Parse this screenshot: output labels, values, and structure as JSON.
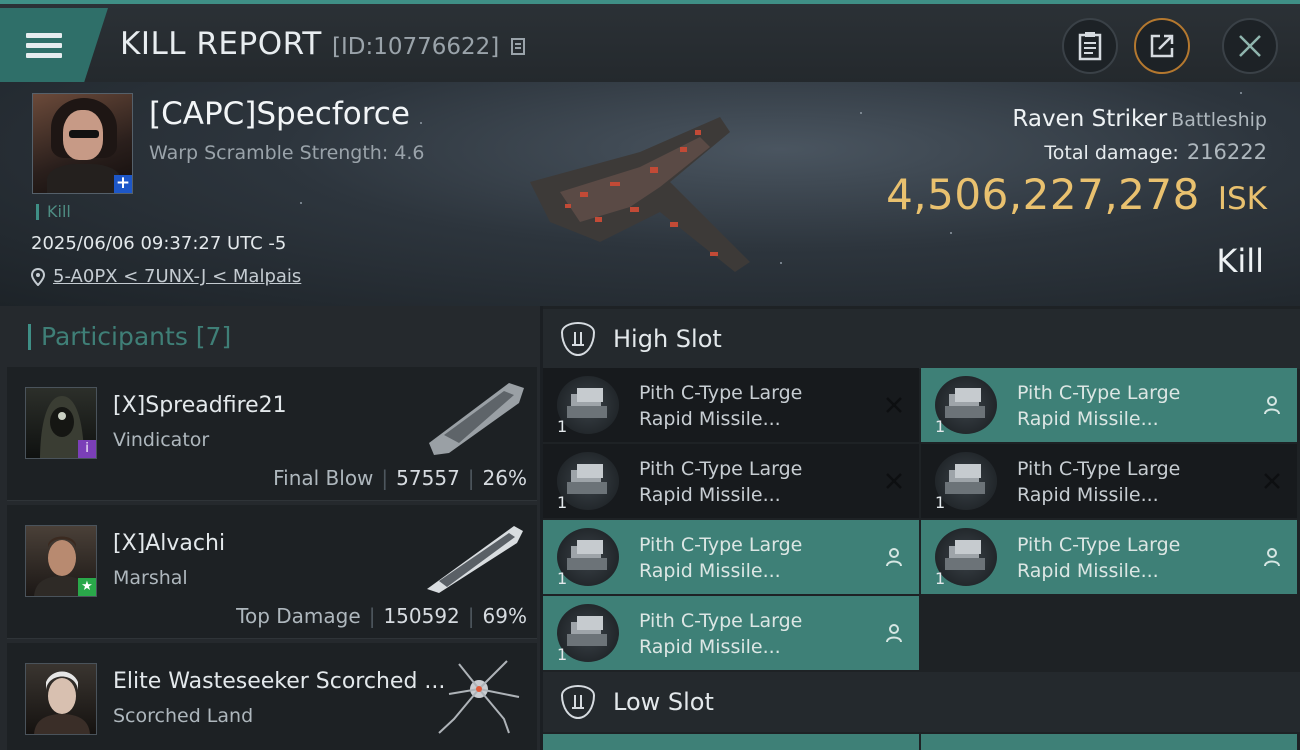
{
  "header": {
    "title": "KILL REPORT",
    "id_label": "[ID:10776622]"
  },
  "victim": {
    "name": "[CAPC]Specforce",
    "scramble": "Warp Scramble Strength: 4.6",
    "kill_tag": "Kill",
    "datetime": "2025/06/06 09:37:27 UTC -5",
    "location": "5-A0PX < 7UNX-J < Malpais",
    "ship_name": "Raven Striker",
    "ship_class": "Battleship",
    "total_damage_label": "Total damage:",
    "total_damage": "216222",
    "isk_value": "4,506,227,278",
    "isk_unit": "ISK",
    "result": "Kill"
  },
  "participants": {
    "heading": "Participants [7]",
    "items": [
      {
        "name": "[X]Spreadfire21",
        "ship": "Vindicator",
        "role": "Final Blow",
        "damage": "57557",
        "percent": "26%"
      },
      {
        "name": "[X]Alvachi",
        "ship": "Marshal",
        "role": "Top Damage",
        "damage": "150592",
        "percent": "69%"
      },
      {
        "name": "Elite Wasteseeker Scorched ...",
        "ship": "Scorched Land",
        "role": "",
        "damage": "",
        "percent": ""
      }
    ]
  },
  "slots": {
    "high_label": "High Slot",
    "low_label": "Low Slot",
    "high_modules": [
      {
        "line1": "Pith C-Type Large",
        "line2": "Rapid Missile...",
        "qty": "1",
        "state": "destroyed"
      },
      {
        "line1": "Pith C-Type Large",
        "line2": "Rapid Missile...",
        "qty": "1",
        "state": "dropped"
      },
      {
        "line1": "Pith C-Type Large",
        "line2": "Rapid Missile...",
        "qty": "1",
        "state": "destroyed"
      },
      {
        "line1": "Pith C-Type Large",
        "line2": "Rapid Missile...",
        "qty": "1",
        "state": "destroyed"
      },
      {
        "line1": "Pith C-Type Large",
        "line2": "Rapid Missile...",
        "qty": "1",
        "state": "dropped"
      },
      {
        "line1": "Pith C-Type Large",
        "line2": "Rapid Missile...",
        "qty": "1",
        "state": "dropped"
      },
      {
        "line1": "Pith C-Type Large",
        "line2": "Rapid Missile...",
        "qty": "1",
        "state": "dropped"
      }
    ]
  },
  "colors": {
    "accent": "#3f8f86",
    "isk_gold": "#e9c16f",
    "dropped_bg": "#3e8077"
  },
  "icons": {
    "menu": "hamburger-icon",
    "clipboard": "clipboard-icon",
    "share": "share-icon",
    "close": "close-icon",
    "location": "location-pin-icon",
    "slot": "high-slot-icon"
  }
}
